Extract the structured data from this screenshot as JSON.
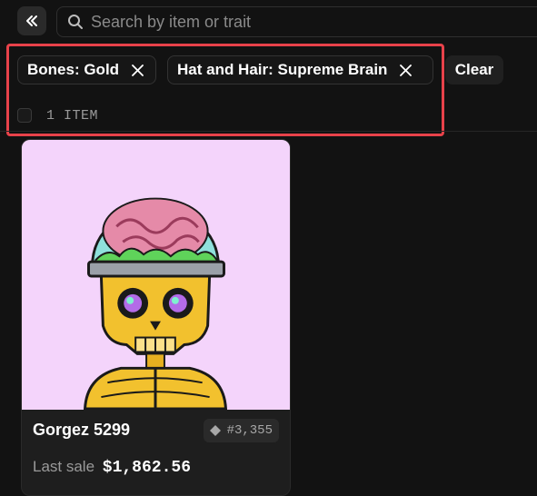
{
  "search": {
    "placeholder": "Search by item or trait"
  },
  "filters": {
    "chips": [
      {
        "label": "Bones: Gold"
      },
      {
        "label": "Hat and Hair: Supreme Brain"
      }
    ],
    "clear_label": "Clear",
    "item_count": "1 ITEM"
  },
  "items": [
    {
      "name": "Gorgez 5299",
      "rank": "#3,355",
      "last_sale_label": "Last sale",
      "last_sale_price": "$1,862.56",
      "bg_color": "#f4d4fb"
    }
  ],
  "colors": {
    "accent_highlight": "#e8424a",
    "background": "#121212"
  },
  "icons": {
    "collapse": "double-chevron-left-icon",
    "search": "search-icon",
    "remove": "close-icon",
    "rarity": "diamond-icon"
  }
}
